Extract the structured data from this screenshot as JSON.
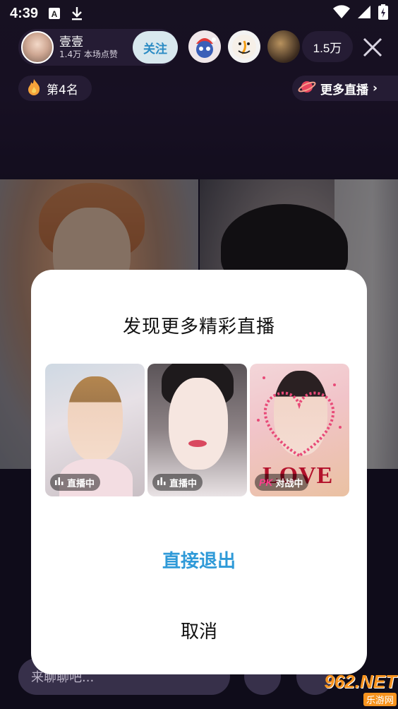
{
  "status_bar": {
    "time": "4:39",
    "icons": [
      "font-a-icon",
      "download-icon",
      "wifi-icon",
      "signal-icon",
      "battery-charging-icon"
    ]
  },
  "host": {
    "name": "壹壹",
    "stats": "1.4万 本场点赞",
    "follow_label": "关注"
  },
  "viewers": {
    "count": "1.5万",
    "avatar_icons": [
      "robot-santa-avatar",
      "smiley-face-avatar",
      "dark-photo-avatar"
    ]
  },
  "rank": {
    "label": "第4名",
    "icon": "fire-icon"
  },
  "more_live": {
    "label": "更多直播",
    "icon": "planet-icon",
    "chevron": "›"
  },
  "chat": {
    "placeholder": "来聊聊吧..."
  },
  "modal": {
    "title": "发现更多精彩直播",
    "cards": [
      {
        "badge": "直播中",
        "badge_icon": "bar-chart-icon"
      },
      {
        "badge": "直播中",
        "badge_icon": "bar-chart-icon"
      },
      {
        "badge": "对战中",
        "badge_icon": "pk-icon",
        "pk_label": "PK",
        "overlay_text": "LOVE"
      }
    ],
    "exit_label": "直接退出",
    "cancel_label": "取消"
  },
  "watermark": {
    "top": "962.NET",
    "bottom": "乐游网"
  },
  "colors": {
    "accent_blue": "#2f9ad8",
    "follow_bg": "#d8e8ee",
    "modal_bg": "#ffffff",
    "watermark_orange": "#f7931e"
  }
}
